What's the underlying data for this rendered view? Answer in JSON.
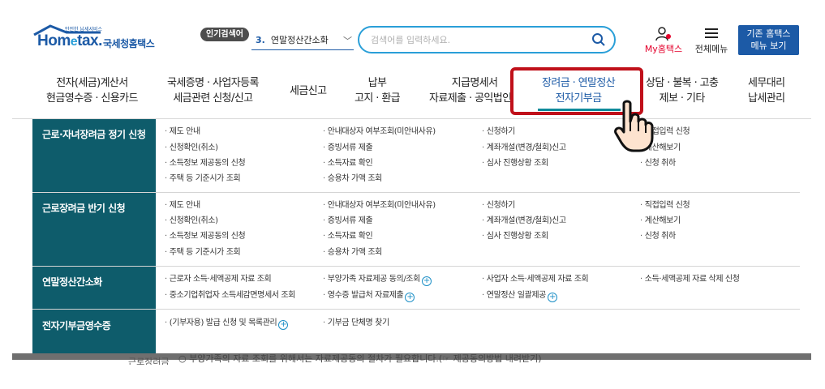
{
  "header": {
    "logo_small": "안전한 납세서비스",
    "logo_en_prefix": "Hom",
    "logo_en_e": "e",
    "logo_en_suffix": "tax.",
    "logo_ko": "국세청홈택스",
    "popular_badge": "인기검색어",
    "popular_rank": "3.",
    "popular_term": "연말정산간소화",
    "search_placeholder": "검색어를 입력하세요.",
    "my_hometax": "My홈택스",
    "all_menu": "전체메뉴",
    "old_hometax_line1": "기존 홈택스",
    "old_hometax_line2": "메뉴 보기"
  },
  "gnb": [
    {
      "line1": "전자(세금)계산서",
      "line2": "현금영수증 · 신용카드"
    },
    {
      "line1": "국세증명 · 사업자등록",
      "line2": "세금관련 신청/신고"
    },
    {
      "line1": "세금신고",
      "line2": ""
    },
    {
      "line1": "납부",
      "line2": "고지 · 환급"
    },
    {
      "line1": "지급명세서",
      "line2": "자료제출 · 공익법인"
    },
    {
      "line1": "장려금 · 연말정산",
      "line2": "전자기부금"
    },
    {
      "line1": "상담 · 불복 · 고충",
      "line2": "제보 · 기타"
    },
    {
      "line1": "세무대리",
      "line2": "납세관리"
    }
  ],
  "panel": {
    "rows": [
      {
        "title": "근로·자녀장려금 정기 신청",
        "cols": [
          [
            "제도 안내",
            "신청확인(취소)",
            "소득정보 제공동의 신청",
            "주택 등 기준시가 조회"
          ],
          [
            "안내대상자 여부조회(미안내사유)",
            "증빙서류 제출",
            "소득자료 확인",
            "승용차 가액 조회"
          ],
          [
            "신청하기",
            "계좌개설(변경/철회)신고",
            "심사 진행상황 조회"
          ],
          [
            "직접입력 신청",
            "계산해보기",
            "신청 취하"
          ]
        ]
      },
      {
        "title": "근로장려금 반기 신청",
        "cols": [
          [
            "제도 안내",
            "신청확인(취소)",
            "소득정보 제공동의 신청",
            "주택 등 기준시가 조회"
          ],
          [
            "안내대상자 여부조회(미안내사유)",
            "증빙서류 제출",
            "소득자료 확인",
            "승용차 가액 조회"
          ],
          [
            "신청하기",
            "계좌개설(변경/철회)신고",
            "심사 진행상황 조회"
          ],
          [
            "직접입력 신청",
            "계산해보기",
            "신청 취하"
          ]
        ]
      },
      {
        "title": "연말정산간소화",
        "cols": [
          [
            "근로자 소득·세액공제 자료 조회",
            "중소기업취업자 소득세감면명세서 조회"
          ],
          [
            "부양가족 자료제공 동의/조회",
            "영수증 발급처 자료제출"
          ],
          [
            "사업자 소득·세액공제 자료 조회",
            "연말정산 일괄제공"
          ],
          [
            "소득·세액공제 자료 삭제 신청"
          ]
        ]
      },
      {
        "title": "전자기부금영수증",
        "cols": [
          [
            "(기부자용) 발급 신청 및 목록관리"
          ],
          [
            "기부금 단체명 찾기"
          ]
        ]
      }
    ],
    "plus_symbol": "+"
  },
  "underlay": {
    "left_text": "근로장려금",
    "notice": "○ 부양가족의 자료 조회를 위해서는 자료제공동의 절차가 필요합니다.(☞ 제공동의방법 내려받기)",
    "notice_link": "☞ 제공동의방법 내려받기"
  },
  "colors": {
    "brand_blue": "#1c5aa6",
    "search_border": "#2a9fd8",
    "panel_teal": "#0e5c6b",
    "highlight_red": "#c0101a",
    "my_red": "#e4002b"
  }
}
